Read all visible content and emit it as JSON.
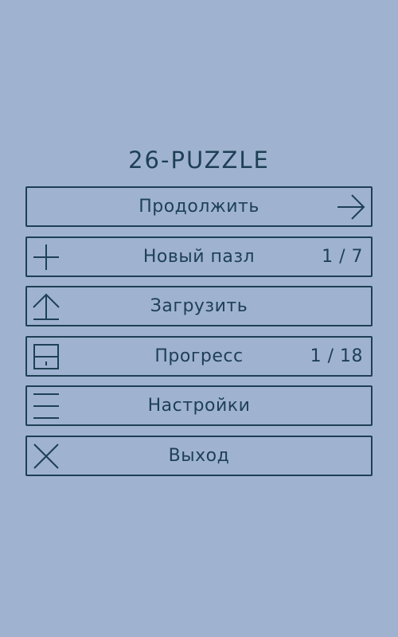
{
  "title": "26-PUZZLE",
  "menu": {
    "continue": {
      "label": "Продолжить",
      "icon": "arrow-right-icon"
    },
    "new_puzzle": {
      "label": "Новый пазл",
      "counter": "1 / 7",
      "icon": "plus-icon"
    },
    "load": {
      "label": "Загрузить",
      "icon": "upload-icon"
    },
    "progress": {
      "label": "Прогресс",
      "counter": "1 / 18",
      "icon": "progress-icon"
    },
    "settings": {
      "label": "Настройки",
      "icon": "menu-lines-icon"
    },
    "exit": {
      "label": "Выход",
      "icon": "close-icon"
    }
  },
  "colors": {
    "background": "#9fb3d0",
    "foreground": "#1e3f55"
  }
}
